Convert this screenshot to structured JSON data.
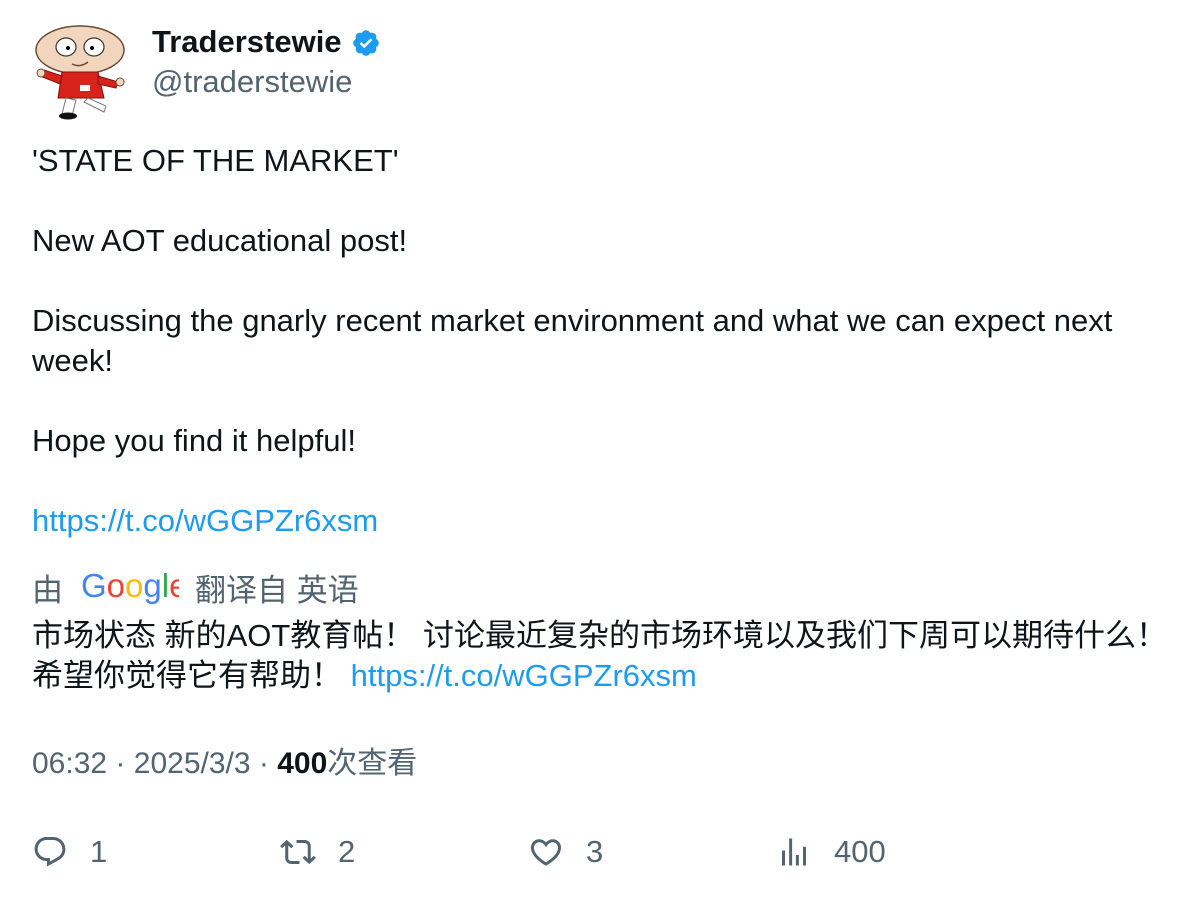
{
  "author": {
    "name": "Traderstewie",
    "handle": "@traderstewie",
    "verified": true
  },
  "tweet": {
    "line1": "'STATE OF THE MARKET'",
    "line2": "New AOT educational post!",
    "line3": "Discussing the gnarly recent market environment and what we can expect next week!",
    "line4": "Hope you find it helpful!",
    "link": "https://t.co/wGGPZr6xsm"
  },
  "translation": {
    "prefix": "由",
    "provider": "Google",
    "suffix": "翻译自 英语",
    "text": "市场状态 新的AOT教育帖！ 讨论最近复杂的市场环境以及我们下周可以期待什么！ 希望你觉得它有帮助！ ",
    "link": "https://t.co/wGGPZr6xsm"
  },
  "meta": {
    "time": "06:32",
    "separator": "·",
    "date": "2025/3/3",
    "views_count": "400",
    "views_label": "次查看"
  },
  "actions": {
    "reply_count": "1",
    "retweet_count": "2",
    "like_count": "3",
    "views_count": "400"
  },
  "colors": {
    "link": "#1d9bf0",
    "secondary_text": "#536471",
    "primary_text": "#0f1419",
    "verified_badge": "#1d9bf0"
  }
}
